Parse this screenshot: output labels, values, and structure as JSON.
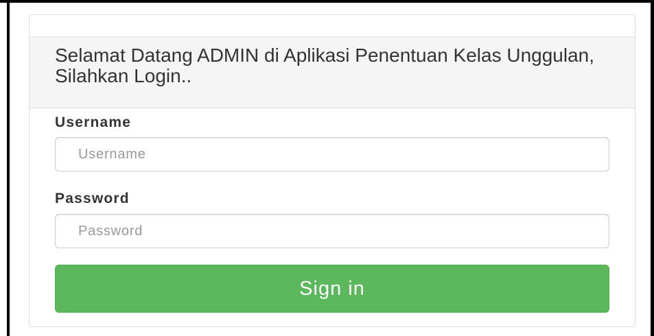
{
  "login_panel": {
    "heading": "Selamat Datang ADMIN di Aplikasi Penentuan Kelas Unggulan, Silahkan Login..",
    "username": {
      "label": "Username",
      "placeholder": "Username",
      "value": ""
    },
    "password": {
      "label": "Password",
      "placeholder": "Password",
      "value": ""
    },
    "signin_label": "Sign in"
  },
  "colors": {
    "success_button": "#5cb85c",
    "heading_background": "#f5f5f5",
    "border": "#dddddd"
  }
}
